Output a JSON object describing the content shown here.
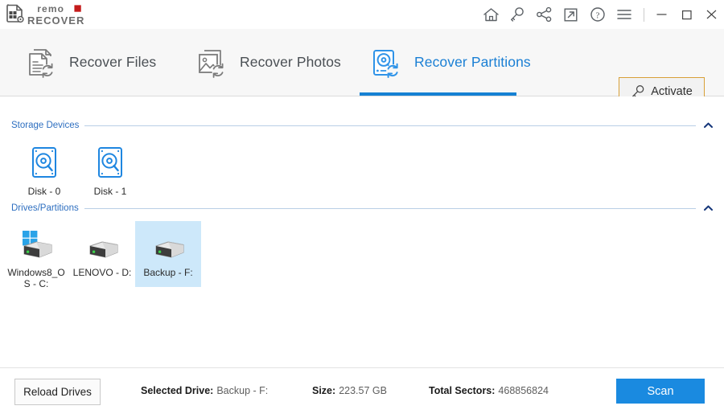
{
  "app": {
    "logo_primary": "remo",
    "logo_secondary": "RECOVER",
    "accent_blue": "#1a8ae0",
    "tab_active_blue": "#1681d3",
    "section_blue": "#2e6fc0",
    "activate_border": "#d8a038",
    "selection_blue": "#cde8fa"
  },
  "titlebar": {
    "icons": [
      {
        "name": "home-icon",
        "label": "Home"
      },
      {
        "name": "key-icon",
        "label": "Activate Key"
      },
      {
        "name": "share-icon",
        "label": "Share"
      },
      {
        "name": "external-link-icon",
        "label": "Open External"
      },
      {
        "name": "help-icon",
        "label": "Help"
      },
      {
        "name": "menu-icon",
        "label": "Menu"
      }
    ],
    "window_controls": [
      {
        "name": "minimize-button",
        "glyph": "─"
      },
      {
        "name": "maximize-button",
        "glyph": "□"
      },
      {
        "name": "close-button",
        "glyph": "✕"
      }
    ]
  },
  "tabs": [
    {
      "id": "files",
      "label": "Recover Files",
      "icon": "document-refresh-icon",
      "active": false
    },
    {
      "id": "photos",
      "label": "Recover Photos",
      "icon": "photo-refresh-icon",
      "active": false
    },
    {
      "id": "partitions",
      "label": "Recover Partitions",
      "icon": "disk-refresh-icon",
      "active": true
    }
  ],
  "activate": {
    "label": "Activate",
    "icon": "key-icon"
  },
  "sections": {
    "storage": {
      "title": "Storage Devices",
      "collapse_icon": "chevron-up-icon",
      "devices": [
        {
          "label": "Disk - 0",
          "icon": "disk-search-icon",
          "selected": false
        },
        {
          "label": "Disk - 1",
          "icon": "disk-search-icon",
          "selected": false
        }
      ]
    },
    "drives": {
      "title": "Drives/Partitions",
      "collapse_icon": "chevron-up-icon",
      "devices": [
        {
          "label": "Windows8_OS - C:",
          "icon": "hard-drive-windows-icon",
          "selected": false
        },
        {
          "label": "LENOVO - D:",
          "icon": "hard-drive-icon",
          "selected": false
        },
        {
          "label": "Backup - F:",
          "icon": "hard-drive-icon",
          "selected": true
        }
      ]
    }
  },
  "footer": {
    "reload_label": "Reload Drives",
    "selected_drive_label": "Selected Drive:",
    "selected_drive_value": "Backup - F:",
    "size_label": "Size:",
    "size_value": "223.57 GB",
    "sectors_label": "Total Sectors:",
    "sectors_value": "468856824",
    "scan_label": "Scan"
  }
}
